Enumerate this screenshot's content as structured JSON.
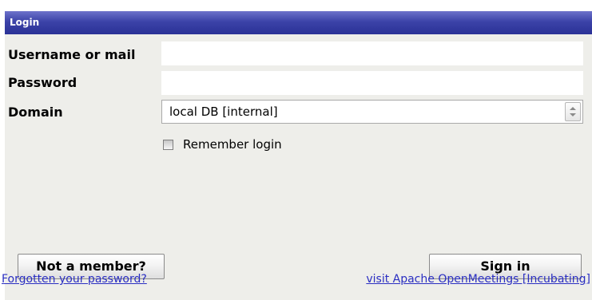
{
  "window": {
    "title": "Login"
  },
  "form": {
    "username_label": "Username or mail",
    "username_value": "",
    "password_label": "Password",
    "password_value": "",
    "domain_label": "Domain",
    "domain_selected": "local DB [internal]",
    "remember_label": "Remember login",
    "remember_checked": false
  },
  "buttons": {
    "not_member": "Not a member?",
    "sign_in": "Sign in"
  },
  "links": {
    "forgot_password": "Forgotten your password?",
    "visit": "visit Apache OpenMeetings [Incubating]"
  },
  "colors": {
    "titlebar": "#3c43a8",
    "panel_background": "#eeeeea",
    "link": "#2a2ec2"
  }
}
